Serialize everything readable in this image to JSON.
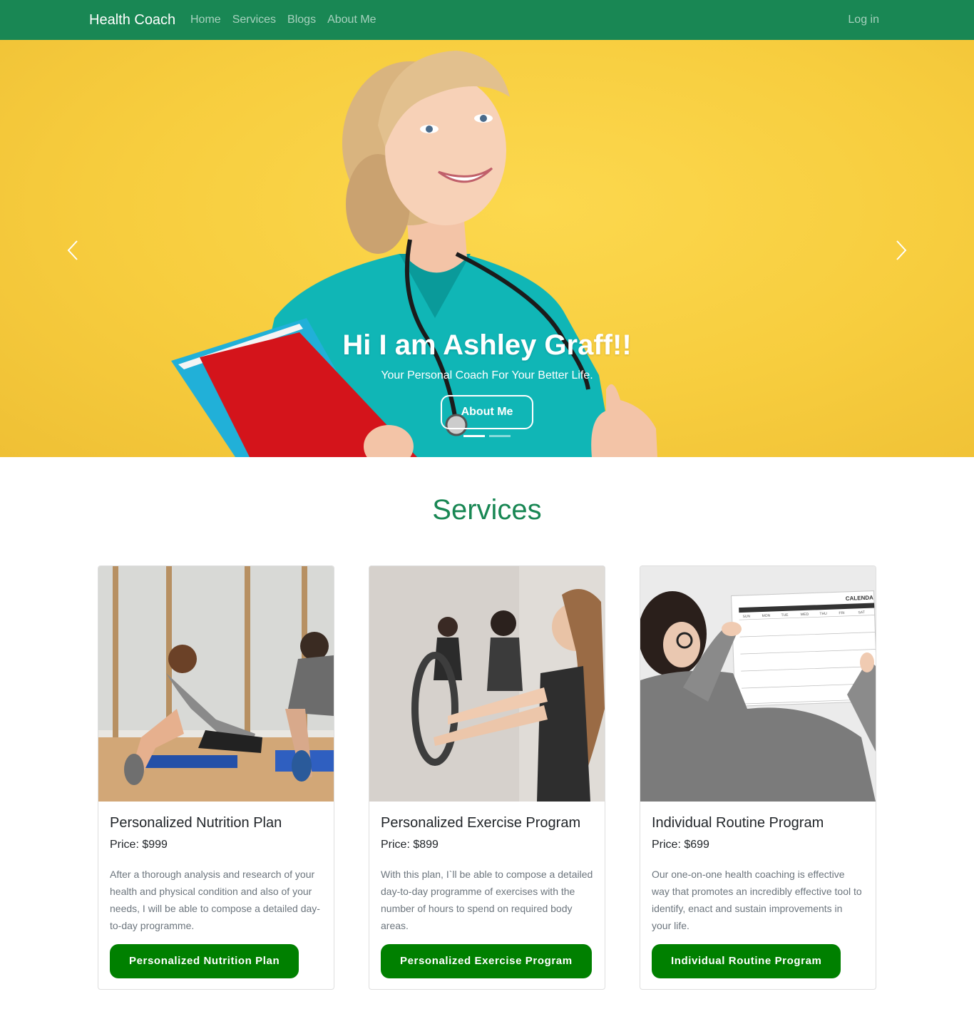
{
  "navbar": {
    "brand": "Health Coach",
    "links": [
      "Home",
      "Services",
      "Blogs",
      "About Me"
    ],
    "login": "Log in"
  },
  "hero": {
    "title": "Hi I am Ashley Graff!!",
    "subtitle": "Your Personal Coach For Your Better Life.",
    "button": "About Me",
    "slide_count": 2,
    "active_slide": 1
  },
  "services": {
    "title": "Services",
    "cards": [
      {
        "title": "Personalized Nutrition Plan",
        "price": "Price: $999",
        "text": "After a thorough analysis and research of your health and physical condition and also of your needs, I will be able to compose a detailed day-to-day programme.",
        "button": "Personalized Nutrition Plan"
      },
      {
        "title": "Personalized Exercise Program",
        "price": "Price: $899",
        "text": "With this plan, I`ll be able to compose a detailed day-to-day programme of exercises with the number of hours to spend on required body areas.",
        "button": "Personalized Exercise Program"
      },
      {
        "title": "Individual Routine Program",
        "price": "Price: $699",
        "text": "Our one-on-one health coaching is effective way that promotes an incredibly effective tool to identify, enact and sustain improvements in your life.",
        "button": "Individual Routine Program"
      }
    ]
  },
  "calendar": {
    "header": "CALENDA",
    "days": [
      "SUN",
      "MON",
      "TUE",
      "WED",
      "THU",
      "FRI",
      "SAT"
    ]
  },
  "colors": {
    "navbar": "#198754",
    "hero_bg": "#f7cd3e",
    "accent_green": "#198754",
    "button_green": "#008000"
  }
}
